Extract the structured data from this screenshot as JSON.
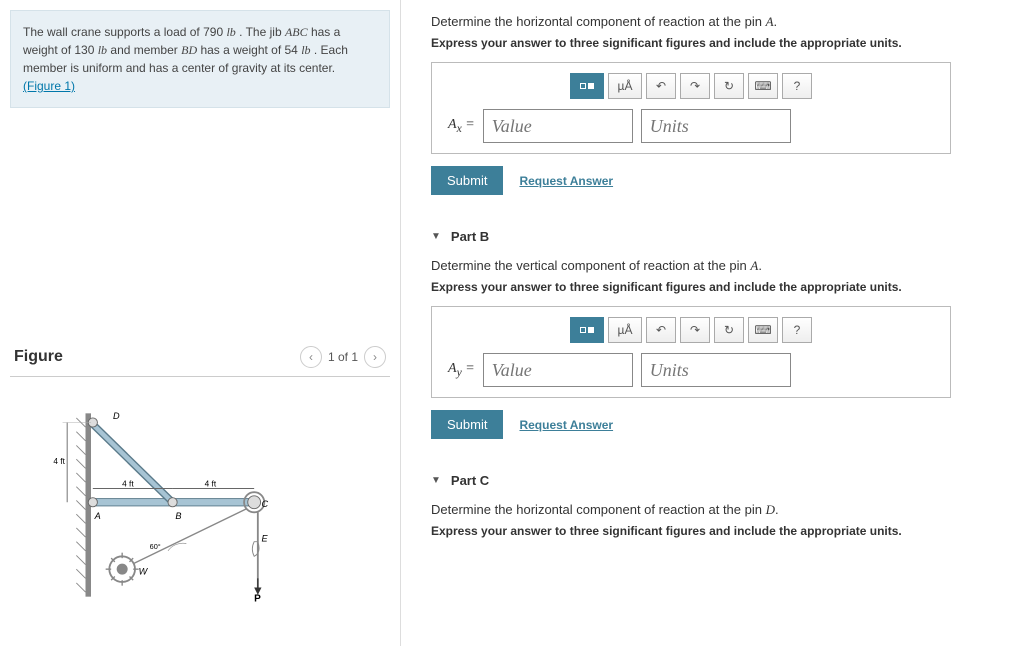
{
  "problem": {
    "text_pre": "The wall crane supports a load of 790 ",
    "unit_lb": "lb",
    "text_mid1": " . The jib ",
    "jib": "ABC",
    "text_mid2": " has a weight of 130 ",
    "text_mid3": " and member ",
    "member": "BD",
    "text_mid4": " has a weight of 54 ",
    "text_end": " . Each member is uniform and has a center of gravity at its center.",
    "figure_link": "(Figure 1)"
  },
  "figure": {
    "title": "Figure",
    "pager": "1 of 1",
    "labels": {
      "D": "D",
      "A": "A",
      "B": "B",
      "C": "C",
      "E": "E",
      "W": "W",
      "P": "P",
      "d1": "4 ft",
      "d2": "4 ft",
      "d3": "4 ft",
      "ang": "60°"
    }
  },
  "partA": {
    "prompt_pre": "Determine the horizontal component of reaction at the pin ",
    "prompt_var": "A",
    "prompt_post": ".",
    "instr": "Express your answer to three significant figures and include the appropriate units.",
    "var_label": "A",
    "var_sub": "x",
    "eq": " = ",
    "value_ph": "Value",
    "units_ph": "Units"
  },
  "partB": {
    "title": "Part B",
    "prompt_pre": "Determine the vertical component of reaction at the pin ",
    "prompt_var": "A",
    "prompt_post": ".",
    "instr": "Express your answer to three significant figures and include the appropriate units.",
    "var_label": "A",
    "var_sub": "y",
    "eq": " = ",
    "value_ph": "Value",
    "units_ph": "Units"
  },
  "partC": {
    "title": "Part C",
    "prompt_pre": "Determine the horizontal component of reaction at the pin ",
    "prompt_var": "D",
    "prompt_post": ".",
    "instr": "Express your answer to three significant figures and include the appropriate units."
  },
  "toolbar": {
    "special": "µÅ",
    "undo": "↶",
    "redo": "↷",
    "reset": "↻",
    "keyboard": "⌨",
    "help": "?"
  },
  "buttons": {
    "submit": "Submit",
    "request": "Request Answer"
  }
}
